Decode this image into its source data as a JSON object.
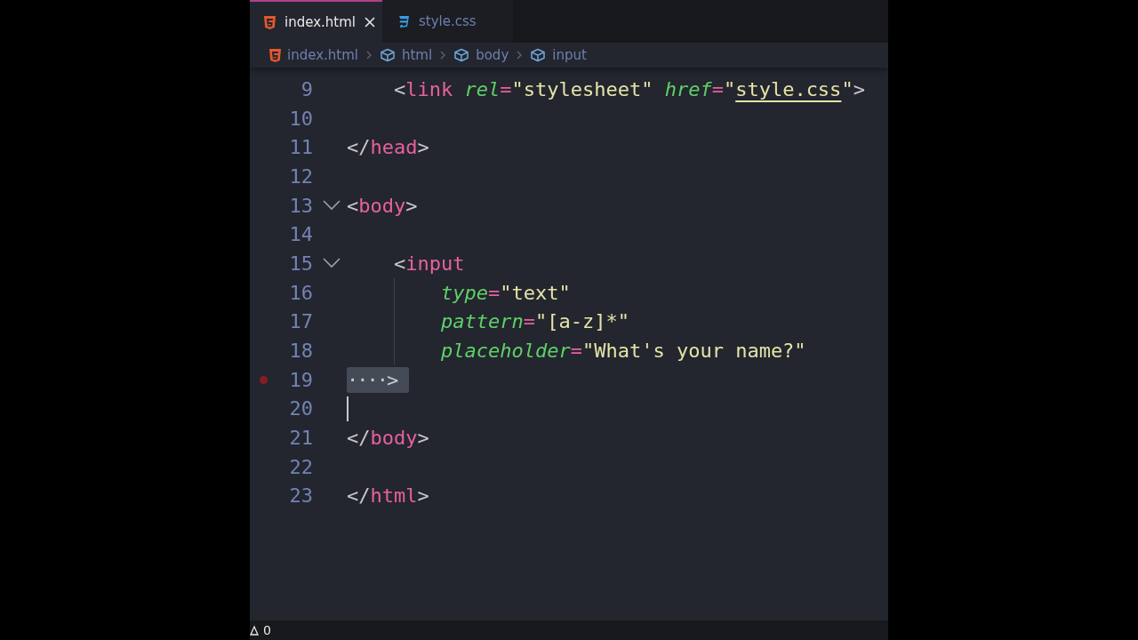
{
  "tabs": [
    {
      "label": "index.html",
      "kind": "html",
      "selected": true,
      "closable": true
    },
    {
      "label": "style.css",
      "kind": "css",
      "selected": false,
      "closable": false
    }
  ],
  "breadcrumb": [
    {
      "label": "index.html",
      "kind": "html"
    },
    {
      "label": "html",
      "kind": "element"
    },
    {
      "label": "body",
      "kind": "element"
    },
    {
      "label": "input",
      "kind": "element"
    }
  ],
  "lines": [
    {
      "number": "9",
      "kind": "nested",
      "fold_chevron": false,
      "breakpoint": false,
      "cursor": false,
      "tokens": [
        {
          "kind": "punct",
          "text": "<"
        },
        {
          "kind": "tag",
          "text": "link"
        },
        {
          "kind": "attr",
          "text": " rel"
        },
        {
          "kind": "eq",
          "text": "="
        },
        {
          "kind": "string",
          "text": "\"stylesheet\""
        },
        {
          "kind": "attr",
          "text": " href"
        },
        {
          "kind": "eq",
          "text": "="
        },
        {
          "kind": "string",
          "text": "\""
        },
        {
          "kind": "link",
          "text": "style.css"
        },
        {
          "kind": "string",
          "text": "\""
        },
        {
          "kind": "punct",
          "text": ">"
        }
      ]
    },
    {
      "number": "10",
      "kind": "top",
      "fold_chevron": false,
      "breakpoint": false,
      "cursor": false
    },
    {
      "number": "11",
      "kind": "top",
      "fold_chevron": false,
      "breakpoint": false,
      "cursor": false,
      "tokens": [
        {
          "kind": "punct",
          "text": "</"
        },
        {
          "kind": "tag",
          "text": "head"
        },
        {
          "kind": "punct",
          "text": ">"
        }
      ]
    },
    {
      "number": "12",
      "kind": "top",
      "fold_chevron": false,
      "breakpoint": false,
      "cursor": false
    },
    {
      "number": "13",
      "kind": "top",
      "fold_chevron": true,
      "breakpoint": false,
      "cursor": false,
      "tokens": [
        {
          "kind": "punct",
          "text": "<"
        },
        {
          "kind": "tag",
          "text": "body"
        },
        {
          "kind": "punct",
          "text": ">"
        }
      ]
    },
    {
      "number": "14",
      "kind": "top",
      "fold_chevron": false,
      "breakpoint": false,
      "cursor": false
    },
    {
      "number": "15",
      "kind": "nested",
      "fold_chevron": true,
      "breakpoint": false,
      "cursor": false,
      "tokens": [
        {
          "kind": "punct",
          "text": "<"
        },
        {
          "kind": "tag",
          "text": "input"
        }
      ]
    },
    {
      "number": "16",
      "kind": "deep",
      "fold_chevron": false,
      "breakpoint": false,
      "cursor": false,
      "tokens": [
        {
          "kind": "attr",
          "text": "type"
        },
        {
          "kind": "eq",
          "text": "="
        },
        {
          "kind": "string",
          "text": "\"text\""
        }
      ]
    },
    {
      "number": "17",
      "kind": "deep",
      "fold_chevron": false,
      "breakpoint": false,
      "cursor": false,
      "tokens": [
        {
          "kind": "attr",
          "text": "pattern"
        },
        {
          "kind": "eq",
          "text": "="
        },
        {
          "kind": "string",
          "text": "\"[a-z]*\""
        }
      ]
    },
    {
      "number": "18",
      "kind": "deep",
      "fold_chevron": false,
      "breakpoint": false,
      "cursor": false,
      "tokens": [
        {
          "kind": "attr",
          "text": "placeholder"
        },
        {
          "kind": "eq",
          "text": "="
        },
        {
          "kind": "string",
          "text": "\"What's your name?\""
        }
      ]
    },
    {
      "number": "19",
      "kind": "top",
      "fold_chevron": false,
      "breakpoint": true,
      "cursor": false,
      "tokens": [
        {
          "kind": "fold",
          "text": "····>"
        }
      ]
    },
    {
      "number": "20",
      "kind": "top",
      "fold_chevron": false,
      "breakpoint": false,
      "cursor": true
    },
    {
      "number": "21",
      "kind": "top",
      "fold_chevron": false,
      "breakpoint": false,
      "cursor": false,
      "tokens": [
        {
          "kind": "punct",
          "text": "</"
        },
        {
          "kind": "tag",
          "text": "body"
        },
        {
          "kind": "punct",
          "text": ">"
        }
      ]
    },
    {
      "number": "22",
      "kind": "top",
      "fold_chevron": false,
      "breakpoint": false,
      "cursor": false
    },
    {
      "number": "23",
      "kind": "top",
      "fold_chevron": false,
      "breakpoint": false,
      "cursor": false,
      "tokens": [
        {
          "kind": "punct",
          "text": "</"
        },
        {
          "kind": "tag",
          "text": "html"
        },
        {
          "kind": "punct",
          "text": ">"
        }
      ]
    }
  ],
  "status_bar": {
    "warnings": "0"
  }
}
